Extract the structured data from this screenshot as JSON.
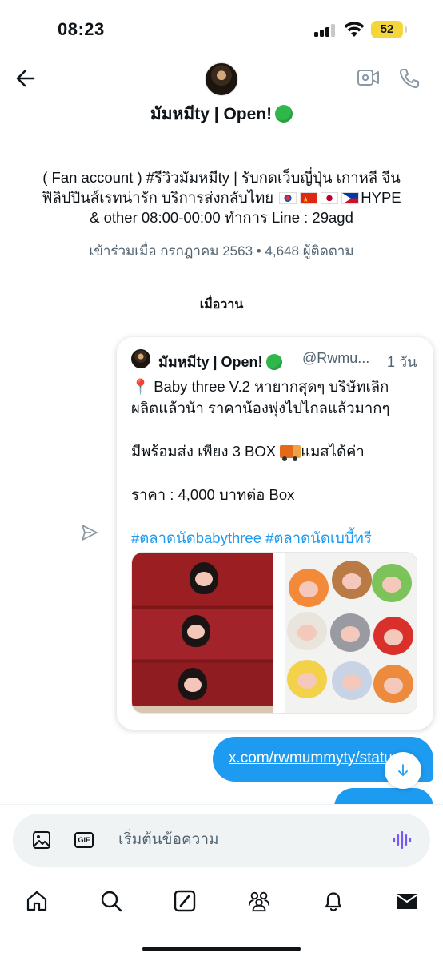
{
  "status_bar": {
    "time": "08:23",
    "battery": "52"
  },
  "header": {
    "name": "มัมหมีty | Open!",
    "bio_line1": "( Fan account ) #รีวิวมัมหมีty | รับกดเว็บญี่ปุ่น เกาหลี จีน",
    "bio_line2_text": "ฟิลิปปินส์เรทน่ารัก บริการส่งกลับไทย",
    "bio_line2_end": "HYPE",
    "bio_line3": "& other 08:00-00:00 ทำการ Line : 29agd",
    "joined": "เข้าร่วมเมื่อ กรกฎาคม 2563 • 4,648 ผู้ติดตาม"
  },
  "conversation": {
    "day_label": "เมื่อวาน",
    "tweet": {
      "author_name": "มัมหมีty | Open!",
      "handle": "@Rwmu...",
      "time": "1 วัน",
      "line1": "Baby three V.2 หายากสุดๆ บริษัทเลิก",
      "line2": "ผลิตแล้วน้า ราคาน้องพุ่งไปไกลแล้วมากๆ",
      "line3_a": "มีพร้อมส่ง เพียง 3 BOX",
      "line3_b": "แมสได้ค่า",
      "line4": "ราคา : 4,000 บาทต่อ Box",
      "hashtags": "#ตลาดนัดbabythree #ตลาดนัดเบบี้ทรี"
    },
    "link_message": "x.com/rwmummyty/status"
  },
  "composer": {
    "placeholder": "เริ่มต้นข้อความ",
    "gif_label": "GIF"
  },
  "nav": [
    "home-icon",
    "search-icon",
    "grok-icon",
    "communities-icon",
    "notifications-icon",
    "messages-icon"
  ],
  "colors": {
    "accent": "#1d9bf0",
    "online": "#2fb74a",
    "battery": "#f5d63a"
  }
}
